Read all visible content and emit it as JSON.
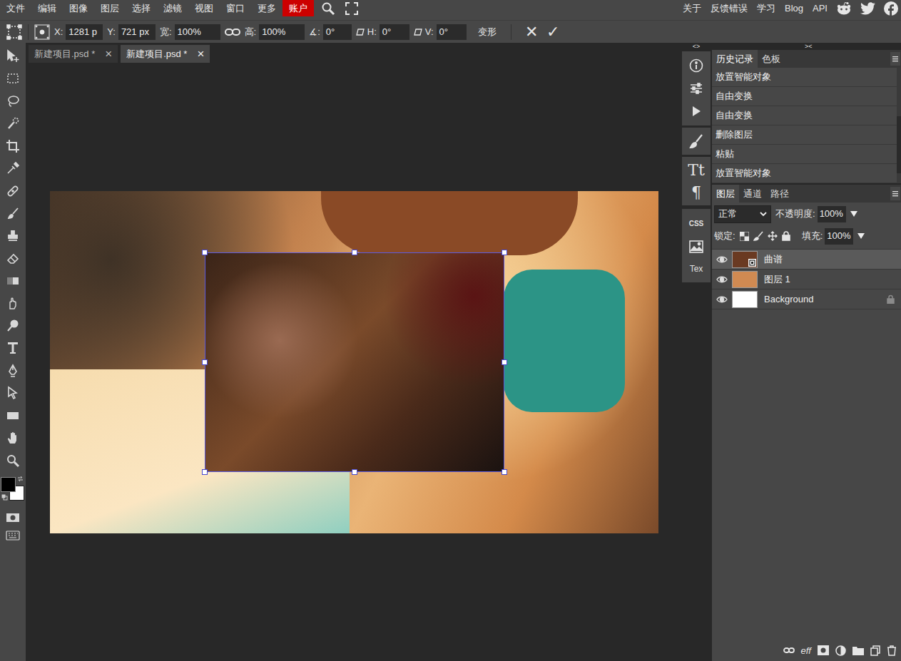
{
  "menu_bar": {
    "items": [
      {
        "label": "文件",
        "highlighted": false
      },
      {
        "label": "编辑",
        "highlighted": false
      },
      {
        "label": "图像",
        "highlighted": false
      },
      {
        "label": "图层",
        "highlighted": false
      },
      {
        "label": "选择",
        "highlighted": false
      },
      {
        "label": "滤镜",
        "highlighted": false
      },
      {
        "label": "视图",
        "highlighted": false
      },
      {
        "label": "窗口",
        "highlighted": false
      },
      {
        "label": "更多",
        "highlighted": false
      },
      {
        "label": "账户",
        "highlighted": true
      }
    ],
    "links": [
      "关于",
      "反馈错误",
      "学习",
      "Blog",
      "API"
    ]
  },
  "options_bar": {
    "fields": [
      {
        "label": "X:",
        "value": "1281 p",
        "kind": "position"
      },
      {
        "label": "Y:",
        "value": "721 px",
        "kind": "position"
      },
      {
        "label": "宽:",
        "value": "100%",
        "kind": "scale-linked"
      },
      {
        "label": "高:",
        "value": "100%",
        "kind": "scale"
      },
      {
        "label": "∡:",
        "value": "0°",
        "kind": "angle"
      },
      {
        "label": "H:",
        "value": "0°",
        "kind": "skew"
      },
      {
        "label": "V:",
        "value": "0°",
        "kind": "skew"
      }
    ],
    "warp": "变形",
    "cancel": "✕",
    "commit": "✓"
  },
  "document_tabs": [
    {
      "label": "新建项目.psd *",
      "close": "×",
      "selected": false
    },
    {
      "label": "新建项目.psd *",
      "close": "×",
      "selected": true
    }
  ],
  "colors": {
    "foreground": "#000000",
    "background": "#ffffff"
  },
  "side_strip": {
    "expand": "<>",
    "type_glyph": "Tt",
    "paragraph_glyph": "¶",
    "css": "CSS",
    "tex": "Tex"
  },
  "panel_strip": {
    "collapse": "><"
  },
  "history_panel": {
    "tabs": [
      {
        "label": "历史记录",
        "selected": true
      },
      {
        "label": "色板",
        "selected": false
      }
    ],
    "items": [
      {
        "label": "放置智能对象",
        "selected": false
      },
      {
        "label": "自由变换",
        "selected": false
      },
      {
        "label": "自由变换",
        "selected": false
      },
      {
        "label": "删除图层",
        "selected": false
      },
      {
        "label": "粘贴",
        "selected": false
      },
      {
        "label": "放置智能对象",
        "selected": false
      }
    ]
  },
  "layers_panel": {
    "tabs": [
      {
        "label": "图层",
        "selected": true
      },
      {
        "label": "通道",
        "selected": false
      },
      {
        "label": "路径",
        "selected": false
      }
    ],
    "blend_mode": "正常",
    "opacity_label": "不透明度:",
    "opacity": "100%",
    "lock_label": "锁定:",
    "fill_label": "填充:",
    "fill": "100%",
    "layers": [
      {
        "name": "曲谱",
        "selected": true,
        "visible": true,
        "locked": false,
        "kind": "smart",
        "color": "#6a3a22"
      },
      {
        "name": "图层 1",
        "selected": false,
        "visible": true,
        "locked": false,
        "kind": "raster",
        "color": "#d08a52"
      },
      {
        "name": "Background",
        "selected": false,
        "visible": true,
        "locked": true,
        "kind": "raster",
        "color": "#ffffff"
      }
    ],
    "effects_label": "eff"
  }
}
